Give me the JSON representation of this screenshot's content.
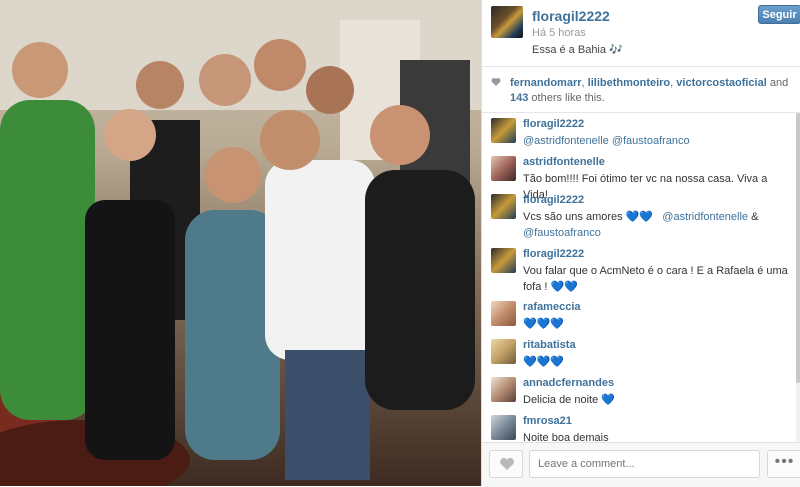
{
  "post": {
    "username": "floragil2222",
    "time": "Há 5 horas",
    "caption": "Essa é a Bahia 🎶",
    "follow_label": "Seguir"
  },
  "likes": {
    "names": [
      "fernandomarr",
      "lilibethmonteiro",
      "victorcosta oficial"
    ],
    "name1": "fernandomarr",
    "name2": "lilibethmonteiro",
    "name3": "victorcostaoficial",
    "and": "and",
    "count": "143",
    "suffix": "others like this."
  },
  "comments": [
    {
      "user": "floragil2222",
      "text": "@astridfontenelle @faustoafranco"
    },
    {
      "user": "astridfontenelle",
      "text": "Tão bom!!!! Foi ótimo ter vc na nossa casa. Viva a Vida!"
    },
    {
      "user": "floragil2222",
      "text_start": "Vcs são uns amores 💙💙",
      "mention1": "@astridfontenelle",
      "amp": "&",
      "mention2": "@faustoafranco"
    },
    {
      "user": "floragil2222",
      "text": "Vou falar que o AcmNeto é o cara ! E a Rafaela é uma fofa ! 💙💙"
    },
    {
      "user": "rafameccia",
      "text": "💙💙💙"
    },
    {
      "user": "ritabatista",
      "text": "💙💙💙"
    },
    {
      "user": "annadcfernandes",
      "text": "Delicia de noite 💙"
    },
    {
      "user": "fmrosa21",
      "text": "Noite boa demais"
    }
  ],
  "footer": {
    "comment_placeholder": "Leave a comment...",
    "more_label": "•••"
  },
  "colors": {
    "link": "#3f729b",
    "follow": "#4a7fb0"
  },
  "icons": {
    "like": "heart-icon",
    "more": "ellipsis-icon"
  }
}
